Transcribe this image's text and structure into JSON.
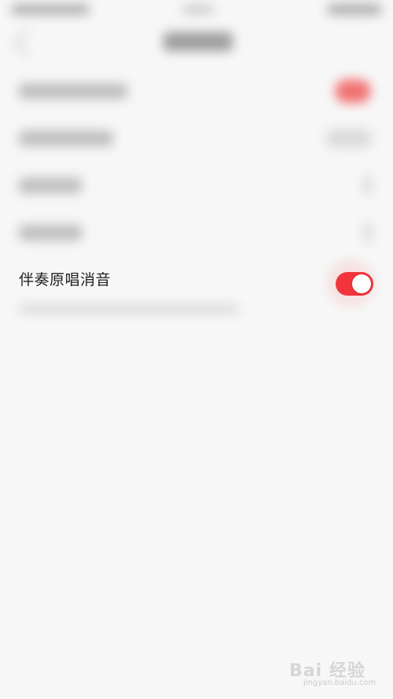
{
  "setting": {
    "label": "伴奏原唱消音",
    "enabled": true
  },
  "colors": {
    "background": "#f7f7f7",
    "toggle_on": "#f2353c",
    "text": "#222222"
  },
  "watermark": {
    "logo": "Bai 经验",
    "url": "jingyan.baidu.com"
  }
}
